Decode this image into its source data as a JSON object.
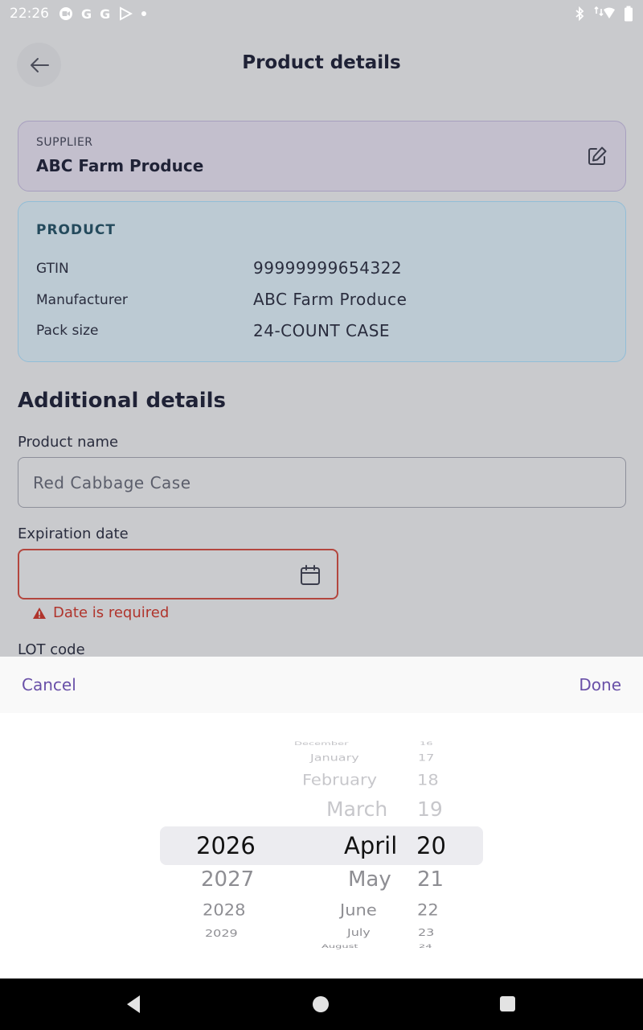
{
  "status_bar": {
    "time": "22:26",
    "left_icons": [
      "camera-icon",
      "google-icon",
      "google-icon",
      "play-store-icon",
      "dot-icon"
    ],
    "right_icons": [
      "bluetooth-icon",
      "wifi-icon",
      "battery-icon"
    ]
  },
  "header": {
    "title": "Product details",
    "back_icon": "arrow-left-icon"
  },
  "supplier": {
    "label": "SUPPLIER",
    "name": "ABC Farm Produce",
    "edit_icon": "edit-icon"
  },
  "product": {
    "title": "PRODUCT",
    "rows": [
      {
        "label": "GTIN",
        "value": "99999999654322"
      },
      {
        "label": "Manufacturer",
        "value": "ABC Farm Produce"
      },
      {
        "label": "Pack size",
        "value": "24-COUNT CASE"
      }
    ]
  },
  "additional": {
    "title": "Additional details",
    "product_name_label": "Product name",
    "product_name_value": "Red Cabbage Case",
    "expiration_label": "Expiration date",
    "expiration_value": "",
    "error_text": "Date is required",
    "lot_label": "LOT code"
  },
  "picker_toolbar": {
    "cancel": "Cancel",
    "done": "Done"
  },
  "picker": {
    "years": [
      "2026",
      "2027",
      "2028",
      "2029"
    ],
    "months": [
      "December",
      "January",
      "February",
      "March",
      "April",
      "May",
      "June",
      "July",
      "August"
    ],
    "days": [
      "16",
      "17",
      "18",
      "19",
      "20",
      "21",
      "22",
      "23",
      "24"
    ],
    "selected": {
      "year": "2026",
      "month": "April",
      "day": "20"
    }
  },
  "colors": {
    "accent": "#6950a8",
    "error": "#b0342c",
    "supplier_bg": "#c3bfcd",
    "product_bg": "#bccad3"
  }
}
